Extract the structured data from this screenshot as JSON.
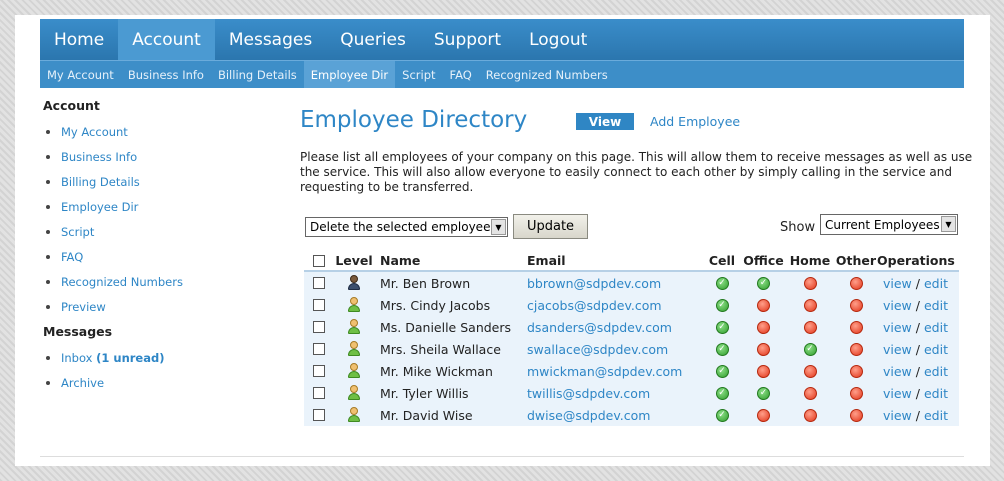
{
  "nav": {
    "main": [
      "Home",
      "Account",
      "Messages",
      "Queries",
      "Support",
      "Logout"
    ],
    "sub": [
      "My Account",
      "Business Info",
      "Billing Details",
      "Employee Dir",
      "Script",
      "FAQ",
      "Recognized Numbers"
    ]
  },
  "sidebar": {
    "account_heading": "Account",
    "account_items": [
      "My Account",
      "Business Info",
      "Billing Details",
      "Employee Dir",
      "Script",
      "FAQ",
      "Recognized Numbers",
      "Preview"
    ],
    "messages_heading": "Messages",
    "inbox_label": "Inbox",
    "inbox_unread": "(1 unread)",
    "archive_label": "Archive"
  },
  "main": {
    "title": "Employee Directory",
    "view_button": "View",
    "add_employee_link": "Add Employee",
    "intro": "Please list all employees of your company on this page. This will allow them to receive messages as well as use the service. This will also allow everyone to easily connect to each other by simply calling in the service and requesting to be transferred.",
    "action_select_value": "Delete the selected employees",
    "update_button": "Update",
    "show_label": "Show",
    "show_select_value": "Current Employees"
  },
  "table": {
    "headers": {
      "level": "Level",
      "name": "Name",
      "email": "Email",
      "cell": "Cell",
      "office": "Office",
      "home": "Home",
      "other": "Other",
      "operations": "Operations"
    },
    "view_label": "view",
    "separator": "/",
    "edit_label": "edit",
    "rows": [
      {
        "name": "Mr. Ben Brown",
        "email": "bbrown@sdpdev.com",
        "level": "admin",
        "cell": "ok",
        "office": "ok",
        "home": "no",
        "other": "no"
      },
      {
        "name": "Mrs. Cindy Jacobs",
        "email": "cjacobs@sdpdev.com",
        "level": "employee",
        "cell": "ok",
        "office": "no",
        "home": "no",
        "other": "no"
      },
      {
        "name": "Ms. Danielle Sanders",
        "email": "dsanders@sdpdev.com",
        "level": "employee",
        "cell": "ok",
        "office": "no",
        "home": "no",
        "other": "no"
      },
      {
        "name": "Mrs. Sheila Wallace",
        "email": "swallace@sdpdev.com",
        "level": "employee",
        "cell": "ok",
        "office": "no",
        "home": "ok",
        "other": "no"
      },
      {
        "name": "Mr. Mike Wickman",
        "email": "mwickman@sdpdev.com",
        "level": "employee",
        "cell": "ok",
        "office": "no",
        "home": "no",
        "other": "no"
      },
      {
        "name": "Mr. Tyler Willis",
        "email": "twillis@sdpdev.com",
        "level": "employee",
        "cell": "ok",
        "office": "ok",
        "home": "no",
        "other": "no"
      },
      {
        "name": "Mr. David Wise",
        "email": "dwise@sdpdev.com",
        "level": "employee",
        "cell": "ok",
        "office": "no",
        "home": "no",
        "other": "no"
      }
    ]
  },
  "colors": {
    "brand_blue": "#2f7fba",
    "link": "#2e86c6",
    "ok": "#2f9d2b",
    "no": "#e2361b"
  },
  "icons": {
    "level_admin": "admin-user-icon",
    "level_employee": "user-icon",
    "ok": "check-circle-icon",
    "no": "red-dot-icon"
  }
}
